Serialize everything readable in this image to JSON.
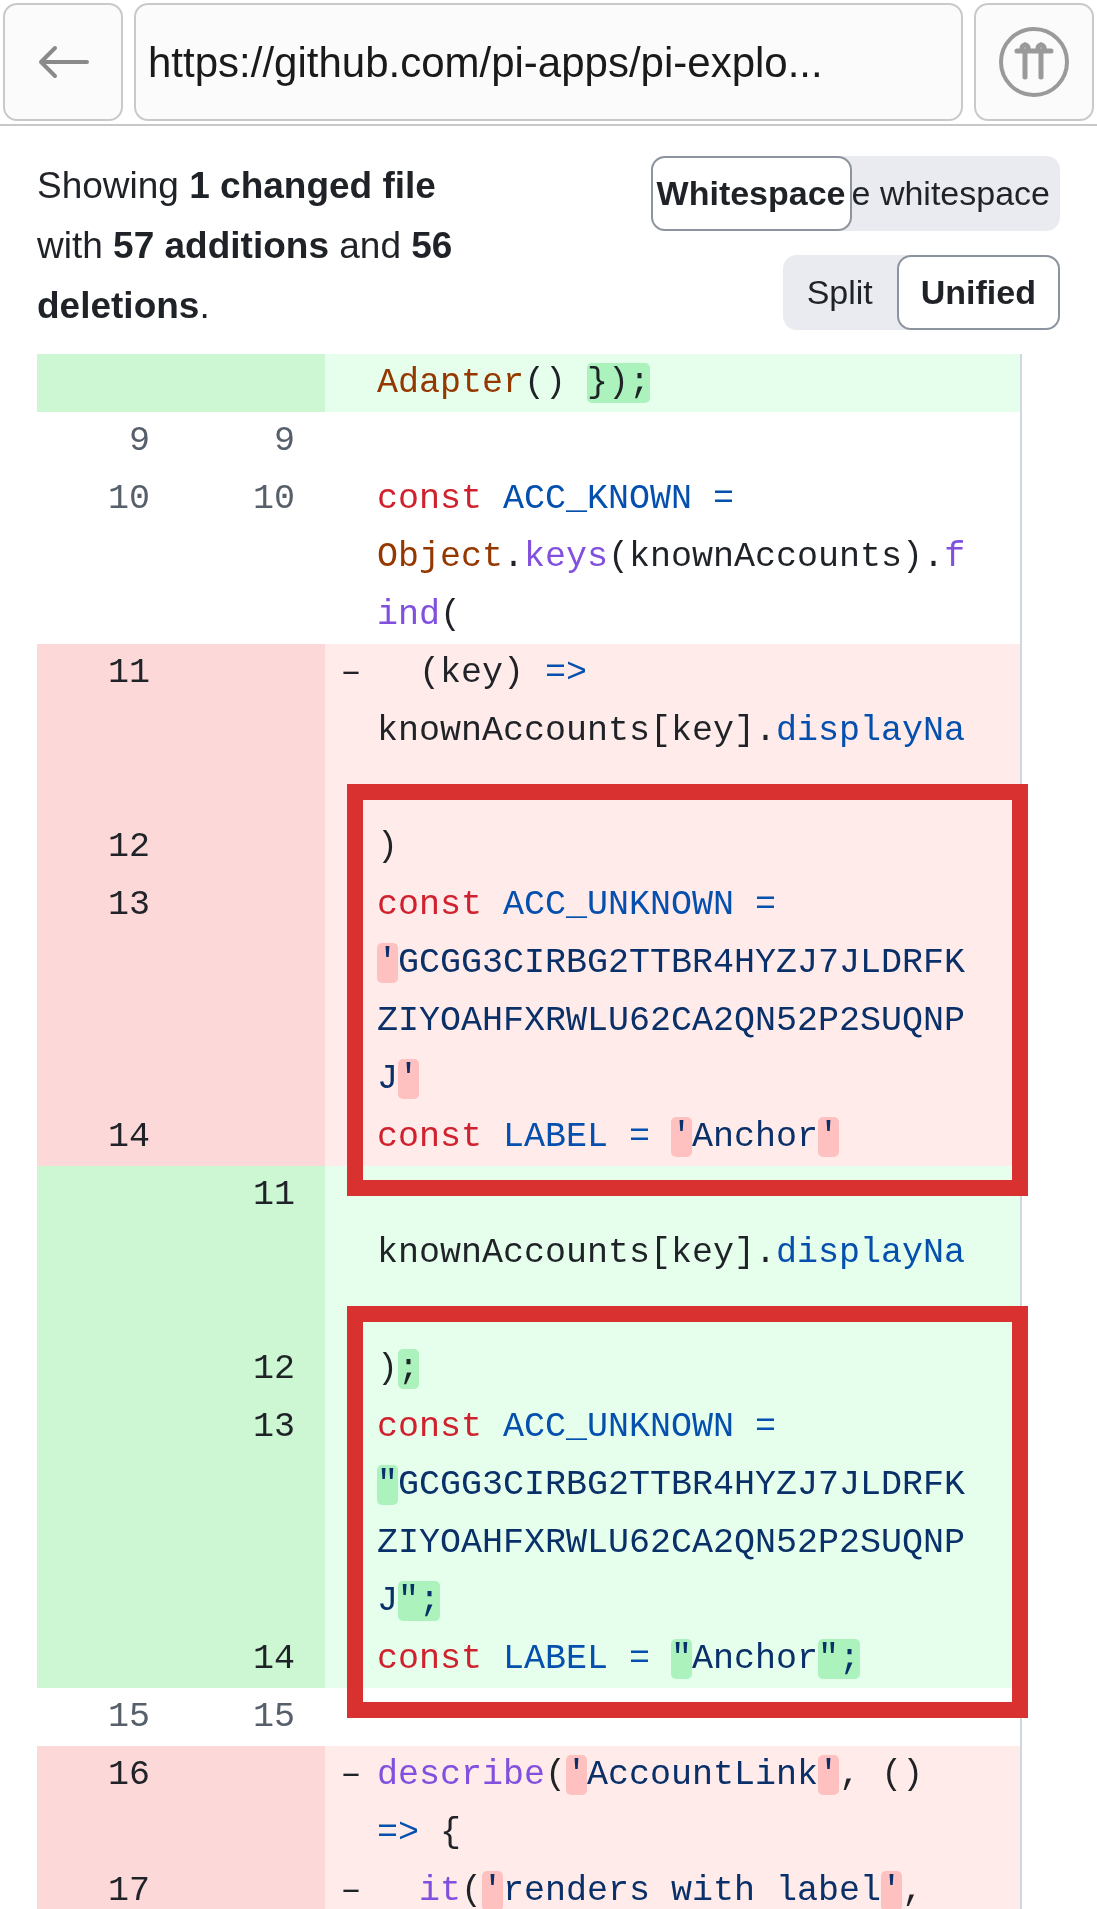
{
  "browser": {
    "url": "https://github.com/pi-apps/pi-explo..."
  },
  "summary": "Showing **1 changed file** with **57 additions** and **56 deletions**.",
  "whitespace_toggle": {
    "button": "Whitespace",
    "label": "e whitespace"
  },
  "view_modes": [
    {
      "label": "Split",
      "selected": false
    },
    {
      "label": "Unified",
      "selected": true
    }
  ],
  "rows": [
    {
      "kind": "addition",
      "boxed": false,
      "lines": [
        [
          {
            "text": "Adapter",
            "kind": "object",
            "changed": false
          },
          {
            "text": "() ",
            "kind": "plain",
            "changed": false
          },
          {
            "text": "});",
            "kind": "plain",
            "changed": true
          }
        ]
      ]
    },
    {
      "kind": "context",
      "old_number": "9",
      "new_number": "9"
    },
    {
      "kind": "context",
      "old_number": "10",
      "new_number": "10",
      "lines": [
        [
          {
            "text": "const ",
            "kind": "keyword",
            "changed": false
          },
          {
            "text": "ACC_KNOWN =",
            "kind": "constant",
            "changed": false
          }
        ],
        [
          {
            "text": "Object",
            "kind": "object",
            "changed": false
          },
          {
            "text": ".",
            "kind": "plain",
            "changed": false
          },
          {
            "text": "keys",
            "kind": "function",
            "changed": false
          },
          {
            "text": "(knownAccounts).",
            "kind": "plain",
            "changed": false
          },
          {
            "text": "f",
            "kind": "function",
            "changed": false
          }
        ],
        [
          {
            "text": "ind",
            "kind": "function",
            "changed": false
          },
          {
            "text": "(",
            "kind": "plain",
            "changed": false
          }
        ]
      ]
    },
    {
      "kind": "deletion",
      "old_number": "11",
      "marker": "–",
      "boxed": false,
      "lines": [
        [
          {
            "text": "  (key) ",
            "kind": "plain",
            "changed": false
          },
          {
            "text": "=>",
            "kind": "constant",
            "changed": false
          }
        ],
        [
          {
            "text": "knownAccounts[key].",
            "kind": "plain",
            "changed": false
          },
          {
            "text": "displayNa",
            "kind": "constant",
            "changed": false
          }
        ]
      ]
    },
    {
      "kind": "deletion",
      "old_number": "12",
      "boxed": true,
      "lines": [
        [
          {
            "text": ")",
            "kind": "plain",
            "changed": false
          }
        ]
      ]
    },
    {
      "kind": "deletion",
      "old_number": "13",
      "boxed": true,
      "lines": [
        [
          {
            "text": "const ",
            "kind": "keyword",
            "changed": false
          },
          {
            "text": "ACC_UNKNOWN =",
            "kind": "constant",
            "changed": false
          }
        ],
        [
          {
            "text": "'",
            "kind": "string",
            "changed": true
          },
          {
            "text": "GCGG3CIRBG2TTBR4HYZJ7JLDRFK",
            "kind": "string",
            "changed": false
          }
        ],
        [
          {
            "text": "ZIYOAHFXRWLU62CA2QN52P2SUQNP",
            "kind": "string",
            "changed": false
          }
        ],
        [
          {
            "text": "J",
            "kind": "string",
            "changed": false
          },
          {
            "text": "'",
            "kind": "string",
            "changed": true
          }
        ]
      ]
    },
    {
      "kind": "deletion",
      "old_number": "14",
      "boxed": true,
      "lines": [
        [
          {
            "text": "const ",
            "kind": "keyword",
            "changed": false
          },
          {
            "text": "LABEL = ",
            "kind": "constant",
            "changed": false
          },
          {
            "text": "'",
            "kind": "string",
            "changed": true
          },
          {
            "text": "Anchor",
            "kind": "string",
            "changed": false
          },
          {
            "text": "'",
            "kind": "string",
            "changed": true
          }
        ]
      ]
    },
    {
      "kind": "addition",
      "new_number": "11",
      "boxed": false,
      "lines": [
        [
          {
            "text": "knownAccounts[key].",
            "kind": "plain",
            "changed": false
          },
          {
            "text": "displayNa",
            "kind": "constant",
            "changed": false
          }
        ]
      ]
    },
    {
      "kind": "addition",
      "new_number": "12",
      "boxed": true,
      "lines": [
        [
          {
            "text": ")",
            "kind": "plain",
            "changed": false
          },
          {
            "text": ";",
            "kind": "plain",
            "changed": true
          }
        ]
      ]
    },
    {
      "kind": "addition",
      "new_number": "13",
      "boxed": true,
      "lines": [
        [
          {
            "text": "const ",
            "kind": "keyword",
            "changed": false
          },
          {
            "text": "ACC_UNKNOWN =",
            "kind": "constant",
            "changed": false
          }
        ],
        [
          {
            "text": "\"",
            "kind": "string",
            "changed": true
          },
          {
            "text": "GCGG3CIRBG2TTBR4HYZJ7JLDRFK",
            "kind": "string",
            "changed": false
          }
        ],
        [
          {
            "text": "ZIYOAHFXRWLU62CA2QN52P2SUQNP",
            "kind": "string",
            "changed": false
          }
        ],
        [
          {
            "text": "J",
            "kind": "string",
            "changed": false
          },
          {
            "text": "\";",
            "kind": "string",
            "changed": true
          }
        ]
      ]
    },
    {
      "kind": "addition",
      "new_number": "14",
      "boxed": true,
      "lines": [
        [
          {
            "text": "const ",
            "kind": "keyword",
            "changed": false
          },
          {
            "text": "LABEL = ",
            "kind": "constant",
            "changed": false
          },
          {
            "text": "\"",
            "kind": "string",
            "changed": true
          },
          {
            "text": "Anchor",
            "kind": "string",
            "changed": false
          },
          {
            "text": "\";",
            "kind": "string",
            "changed": true
          }
        ]
      ]
    },
    {
      "kind": "context",
      "old_number": "15",
      "new_number": "15"
    },
    {
      "kind": "deletion",
      "old_number": "16",
      "marker": "–",
      "boxed": false,
      "lines": [
        [
          {
            "text": "describe",
            "kind": "function",
            "changed": false
          },
          {
            "text": "(",
            "kind": "plain",
            "changed": false
          },
          {
            "text": "'",
            "kind": "string",
            "changed": true
          },
          {
            "text": "AccountLink",
            "kind": "string",
            "changed": false
          },
          {
            "text": "'",
            "kind": "string",
            "changed": true
          },
          {
            "text": ", ()",
            "kind": "plain",
            "changed": false
          }
        ],
        [
          {
            "text": "=> ",
            "kind": "constant",
            "changed": false
          },
          {
            "text": "{",
            "kind": "plain",
            "changed": false
          }
        ]
      ]
    },
    {
      "kind": "deletion",
      "old_number": "17",
      "marker": "–",
      "boxed": false,
      "lines": [
        [
          {
            "text": "  it",
            "kind": "function",
            "changed": false
          },
          {
            "text": "(",
            "kind": "plain",
            "changed": false
          },
          {
            "text": "'",
            "kind": "string",
            "changed": true
          },
          {
            "text": "renders with label",
            "kind": "string",
            "changed": false
          },
          {
            "text": "'",
            "kind": "string",
            "changed": true
          },
          {
            "text": ",",
            "kind": "plain",
            "changed": false
          }
        ]
      ]
    }
  ]
}
